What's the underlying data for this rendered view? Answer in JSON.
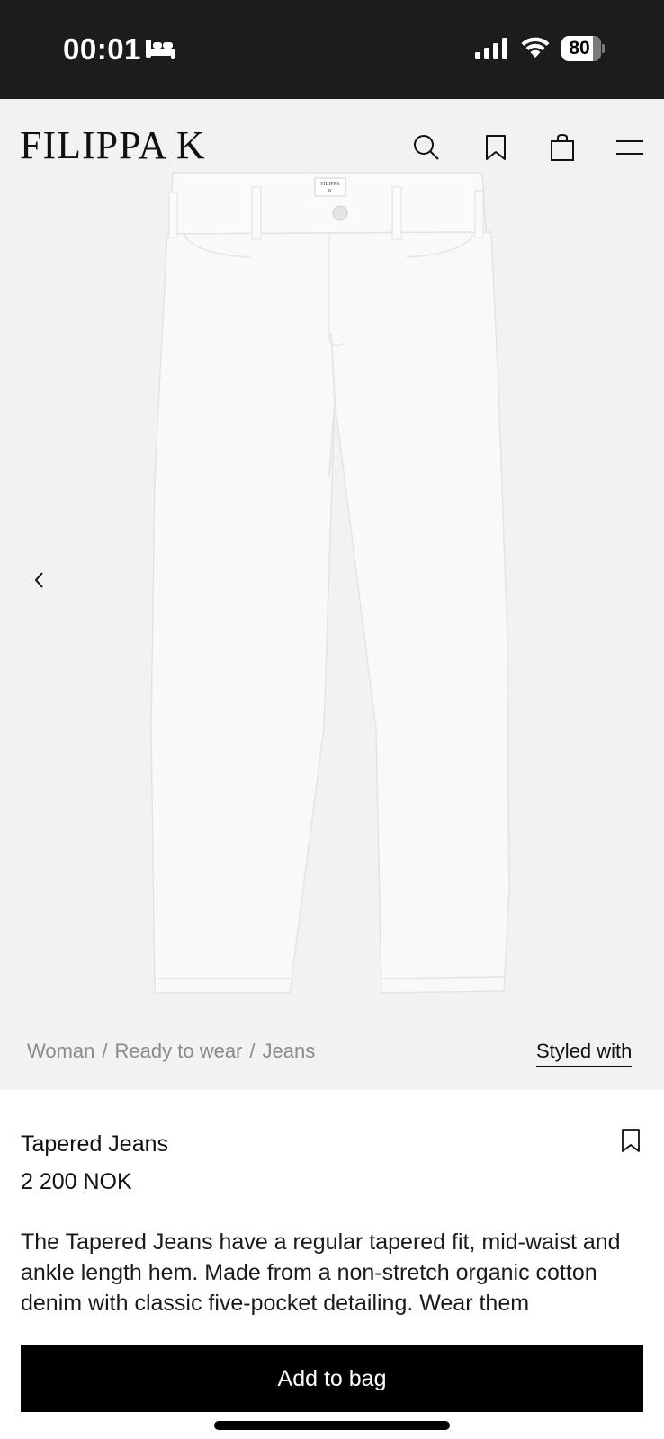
{
  "status_bar": {
    "time": "00:01",
    "battery": "80",
    "icons": [
      "bed-icon",
      "cellular-signal-icon",
      "wifi-icon",
      "battery-icon"
    ]
  },
  "header": {
    "logo": "FILIPPA K",
    "icons": [
      "search-icon",
      "bookmark-icon",
      "shopping-bag-icon",
      "menu-icon"
    ]
  },
  "gallery": {
    "prev_icon": "chevron-left-icon",
    "label_text": "FILIPPA K"
  },
  "breadcrumb": {
    "items": [
      "Woman",
      "Ready to wear",
      "Jeans"
    ],
    "separator": "/"
  },
  "styled_with": "Styled with",
  "product": {
    "name": "Tapered Jeans",
    "price": "2 200 NOK",
    "description": "The Tapered Jeans have a regular tapered fit, mid-waist and ankle length hem. Made from a non-stretch organic cotton denim with classic five-pocket detailing. Wear them"
  },
  "cta": {
    "add_to_bag": "Add to bag"
  },
  "colors": {
    "status_bar_bg": "#1c1c1c",
    "gallery_bg": "#f2f2f2",
    "button_bg": "#000000",
    "breadcrumb_text": "#8a8a8a"
  }
}
